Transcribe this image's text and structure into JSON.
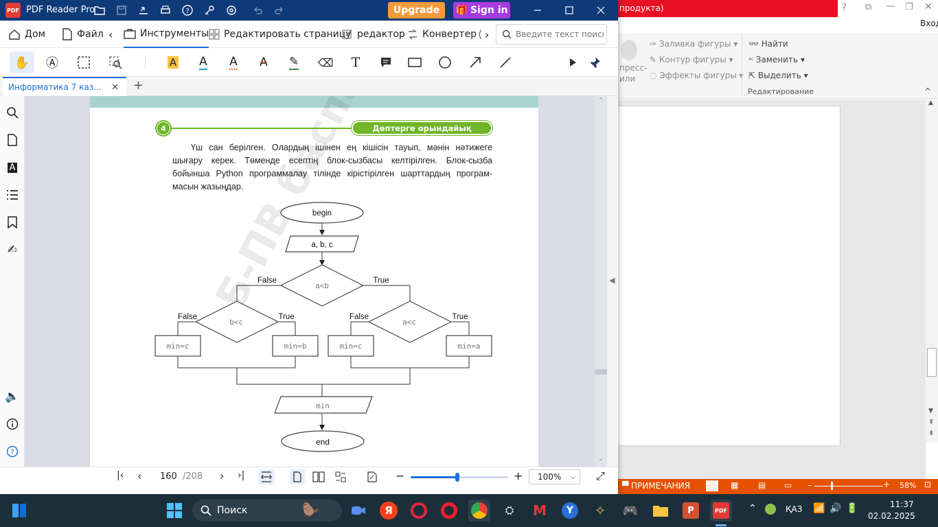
{
  "app": {
    "title": "PDF Reader Pro",
    "upgrade_label": "Upgrade",
    "signin_label": "Sign in"
  },
  "menubar": {
    "home": "Дом",
    "file": "Файл",
    "tools": "Инструменты",
    "edit_page": "Редактировать страницу",
    "editor": "редактор",
    "converter": "Конвертер",
    "search_placeholder": "Введите текст поиска"
  },
  "tab": {
    "title": "Информатика 7 каз..."
  },
  "document": {
    "task_number": "4",
    "task_banner": "Дәптерге орындайық",
    "paragraph_lines": [
      "Үш сан берілген. Олардың ішінен ең кішісін тауып, мәнін нәтижеге",
      "шығару керек. Төменде есептің блок-сызбасы келтірілген. Блок-сызба",
      "бойынша Python программалау тілінде кірістірілген шарттардың програм-",
      "масын жазыңдар."
    ],
    "watermark": "Б-ПВ баспасы",
    "flowchart": {
      "begin": "begin",
      "input": "a, b, c",
      "cond_main": "a<b",
      "cond_left": "b<c",
      "cond_right": "a<c",
      "label_false": "False",
      "label_true": "True",
      "box_ll": "min=c",
      "box_lr": "min=b",
      "box_rl": "min=c",
      "box_rr": "min=a",
      "output": "min",
      "end": "end"
    }
  },
  "pagenav": {
    "current_page": "160",
    "total_pages": "/208",
    "zoom": "100%",
    "zoom_slider_fraction": 0.48
  },
  "ppt": {
    "title_red": "продукта)",
    "enter_label": "Вход",
    "fill_shape": "Заливка фигуры",
    "outline_shape": "Контур фигуры",
    "effects_shape": "Эффекты фигуры",
    "express_styles_1": "пресс-",
    "express_styles_2": "или",
    "find": "Найти",
    "replace": "Заменить",
    "select": "Выделить",
    "editing_group": "Редактирование",
    "notes": "ПРИМЕЧАНИЯ",
    "zoom": "58%"
  },
  "taskbar": {
    "search_label": "Поиск",
    "language": "ҚАЗ",
    "time": "11:37",
    "date": "02.02.2025"
  },
  "colors": {
    "titlebar": "#0e3a78",
    "upgrade": "#f39c3d",
    "signin": "#a63be0",
    "accent": "#1e6fd9",
    "banner_green": "#6fb62a",
    "ppt_red": "#e81123",
    "ppt_status": "#e65100",
    "taskbar": "#1b2f3a"
  }
}
